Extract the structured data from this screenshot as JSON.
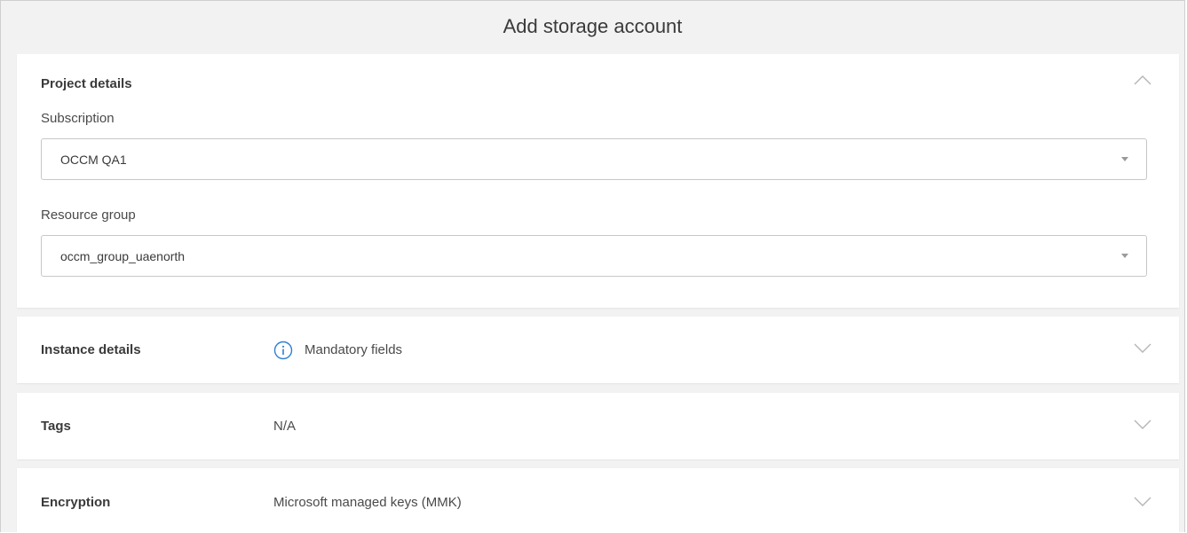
{
  "header": {
    "title": "Add storage account"
  },
  "project_details": {
    "title": "Project details",
    "subscription": {
      "label": "Subscription",
      "value": "OCCM QA1"
    },
    "resource_group": {
      "label": "Resource group",
      "value": "occm_group_uaenorth"
    },
    "expanded": true
  },
  "instance_details": {
    "title": "Instance details",
    "summary": "Mandatory fields",
    "icon": "info-icon",
    "expanded": false
  },
  "tags": {
    "title": "Tags",
    "summary": "N/A",
    "expanded": false
  },
  "encryption": {
    "title": "Encryption",
    "summary": "Microsoft managed keys (MMK)",
    "expanded": false
  },
  "colors": {
    "info_icon": "#2f7fd1",
    "chevron": "#b5b5b5"
  }
}
